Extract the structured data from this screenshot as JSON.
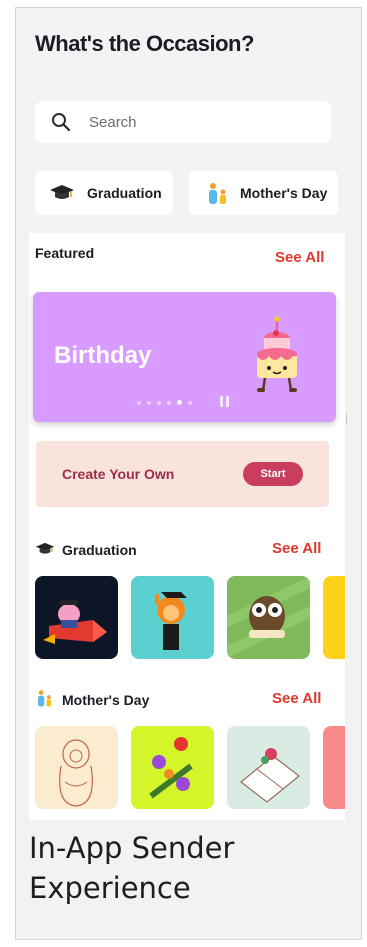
{
  "header": {
    "title": "What's the Occasion?"
  },
  "search": {
    "placeholder": "Search"
  },
  "chips": [
    {
      "label": "Graduation",
      "icon": "graduation-cap-icon"
    },
    {
      "label": "Mother's Day",
      "icon": "mother-child-icon"
    }
  ],
  "featured": {
    "title": "Featured",
    "see_all": "See All",
    "banner": {
      "title": "Birthday",
      "color": "#d89bff",
      "dots": 6,
      "active_dot": 4
    }
  },
  "create": {
    "label": "Create Your Own",
    "button": "Start"
  },
  "sections": [
    {
      "title": "Graduation",
      "see_all": "See All",
      "icon": "graduation-cap-icon",
      "cards": [
        "pig-on-rocket",
        "graduate-monkey",
        "owl-with-diploma",
        "yellow-partial"
      ]
    },
    {
      "title": "Mother's Day",
      "see_all": "See All",
      "icon": "mother-child-icon",
      "cards": [
        "nesting-doll",
        "flower-bouquet",
        "gift-box",
        "pink-partial"
      ]
    }
  ],
  "caption": "In-App Sender Experience",
  "colors": {
    "accent": "#e0382e",
    "start_button": "#c93d5e",
    "create_bg": "#f8e4dc",
    "create_text": "#9c2e45"
  }
}
